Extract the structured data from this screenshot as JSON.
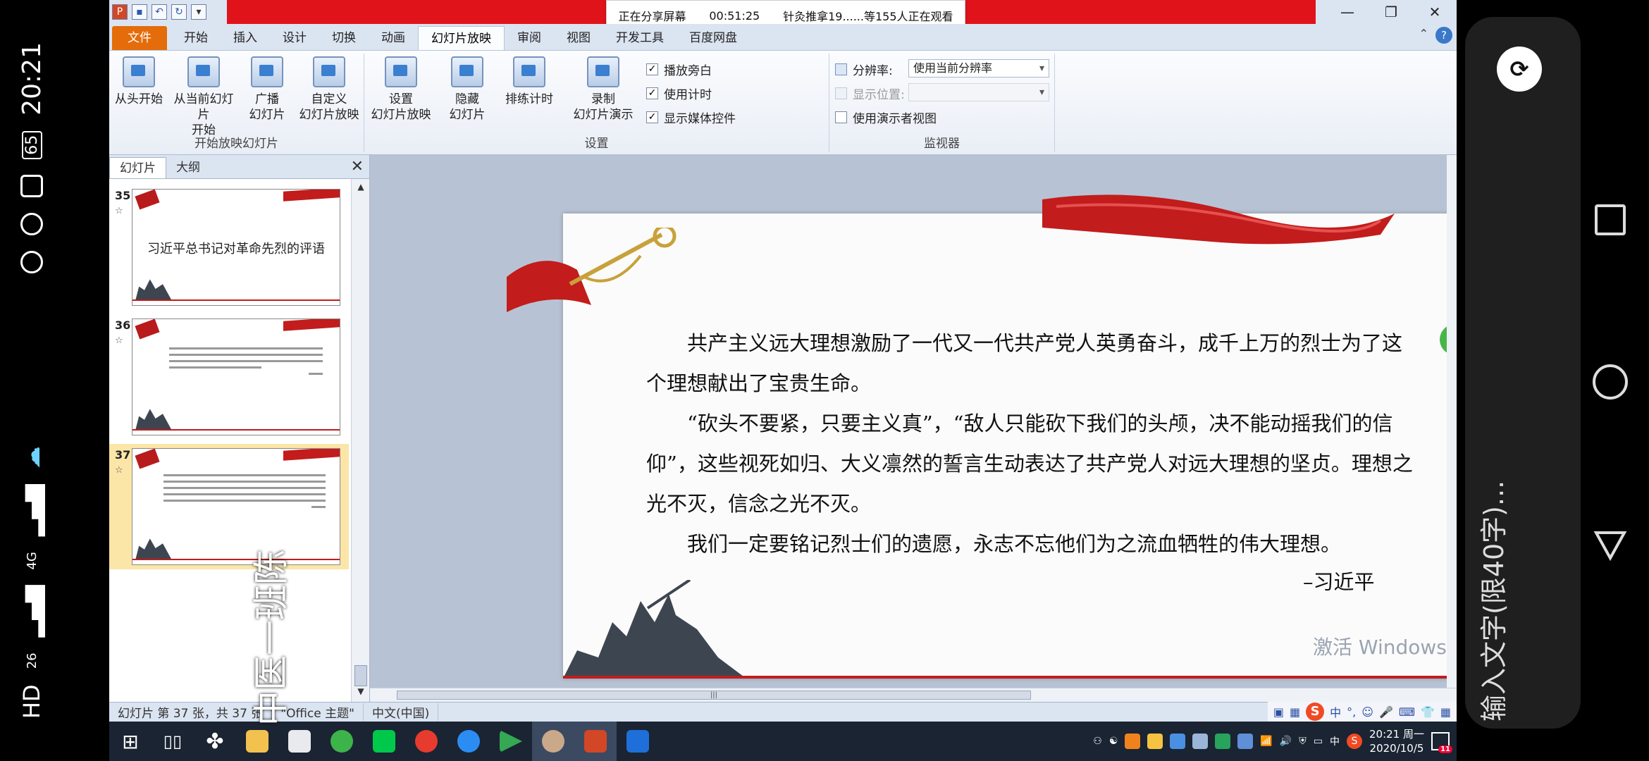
{
  "phone_status": {
    "time": "20:21",
    "battery": "65",
    "network_left": "26",
    "network_right": "4G",
    "hd": "HD"
  },
  "titlebar": {
    "share_status": "正在分享屏幕",
    "share_time": "00:51:25",
    "share_viewers": "针灸推拿19......等155人正在观看"
  },
  "tabs": [
    "文件",
    "开始",
    "插入",
    "设计",
    "切换",
    "动画",
    "幻灯片放映",
    "审阅",
    "视图",
    "开发工具",
    "百度网盘"
  ],
  "active_tab": "幻灯片放映",
  "ribbon": {
    "group_start": {
      "label": "开始放映幻灯片",
      "buttons": [
        "从头开始",
        "从当前幻灯片\n开始",
        "广播\n幻灯片",
        "自定义\n幻灯片放映"
      ]
    },
    "group_setup": {
      "label": "设置",
      "buttons": [
        "设置\n幻灯片放映",
        "隐藏\n幻灯片",
        "排练计时",
        "录制\n幻灯片演示"
      ],
      "checks": [
        {
          "label": "播放旁白",
          "checked": true
        },
        {
          "label": "使用计时",
          "checked": true
        },
        {
          "label": "显示媒体控件",
          "checked": true
        }
      ]
    },
    "group_monitor": {
      "label": "监视器",
      "resolution_label": "分辨率:",
      "resolution_value": "使用当前分辨率",
      "position_label": "显示位置:",
      "presenter_view": "使用演示者视图"
    }
  },
  "panel": {
    "tab_slides": "幻灯片",
    "tab_outline": "大纲",
    "thumbnails": [
      {
        "num": "35",
        "title": "习近平总书记对革命先烈的评语",
        "text": "",
        "foot": "",
        "selected": false
      },
      {
        "num": "36",
        "title": "",
        "text": "",
        "foot": "",
        "selected": false
      },
      {
        "num": "37",
        "title": "",
        "text": "",
        "foot": "",
        "selected": true
      }
    ]
  },
  "slide": {
    "paragraphs": [
      "共产主义远大理想激励了一代又一代共产党人英勇奋斗，成千上万的烈士为了这个理想献出了宝贵生命。",
      "“砍头不要紧，只要主义真”，“敌人只能砍下我们的头颅，决不能动摇我们的信仰”，这些视死如归、大义凛然的誓言生动表达了共产党人对远大理想的坚贞。理想之光不灭，信念之光不灭。",
      "我们一定要铭记烈士们的遗愿，永志不忘他们为之流血牺牲的伟大理想。"
    ],
    "signature": "–习近平",
    "watermark_line1": "激活 Windows"
  },
  "statusbar": {
    "slide_info": "幻灯片 第 37 张，共 37 张",
    "theme": "\"Office 主题\"",
    "language": "中文(中国)"
  },
  "ime": {
    "chinese": "中"
  },
  "taskbar": {
    "clock_time": "20:21 周一",
    "clock_date": "2020/10/5",
    "tray_lang": "中",
    "notif_count": "11"
  },
  "overlay": {
    "class_tag": "中医一班陈"
  },
  "chat": {
    "input_placeholder": "输入文字(限40字)..."
  },
  "colors": {
    "red_banner": "#e0131b",
    "file_tab": "#e46c0a",
    "ribbon_bg": "#dbe4f1",
    "taskbar": "#1a2433"
  }
}
